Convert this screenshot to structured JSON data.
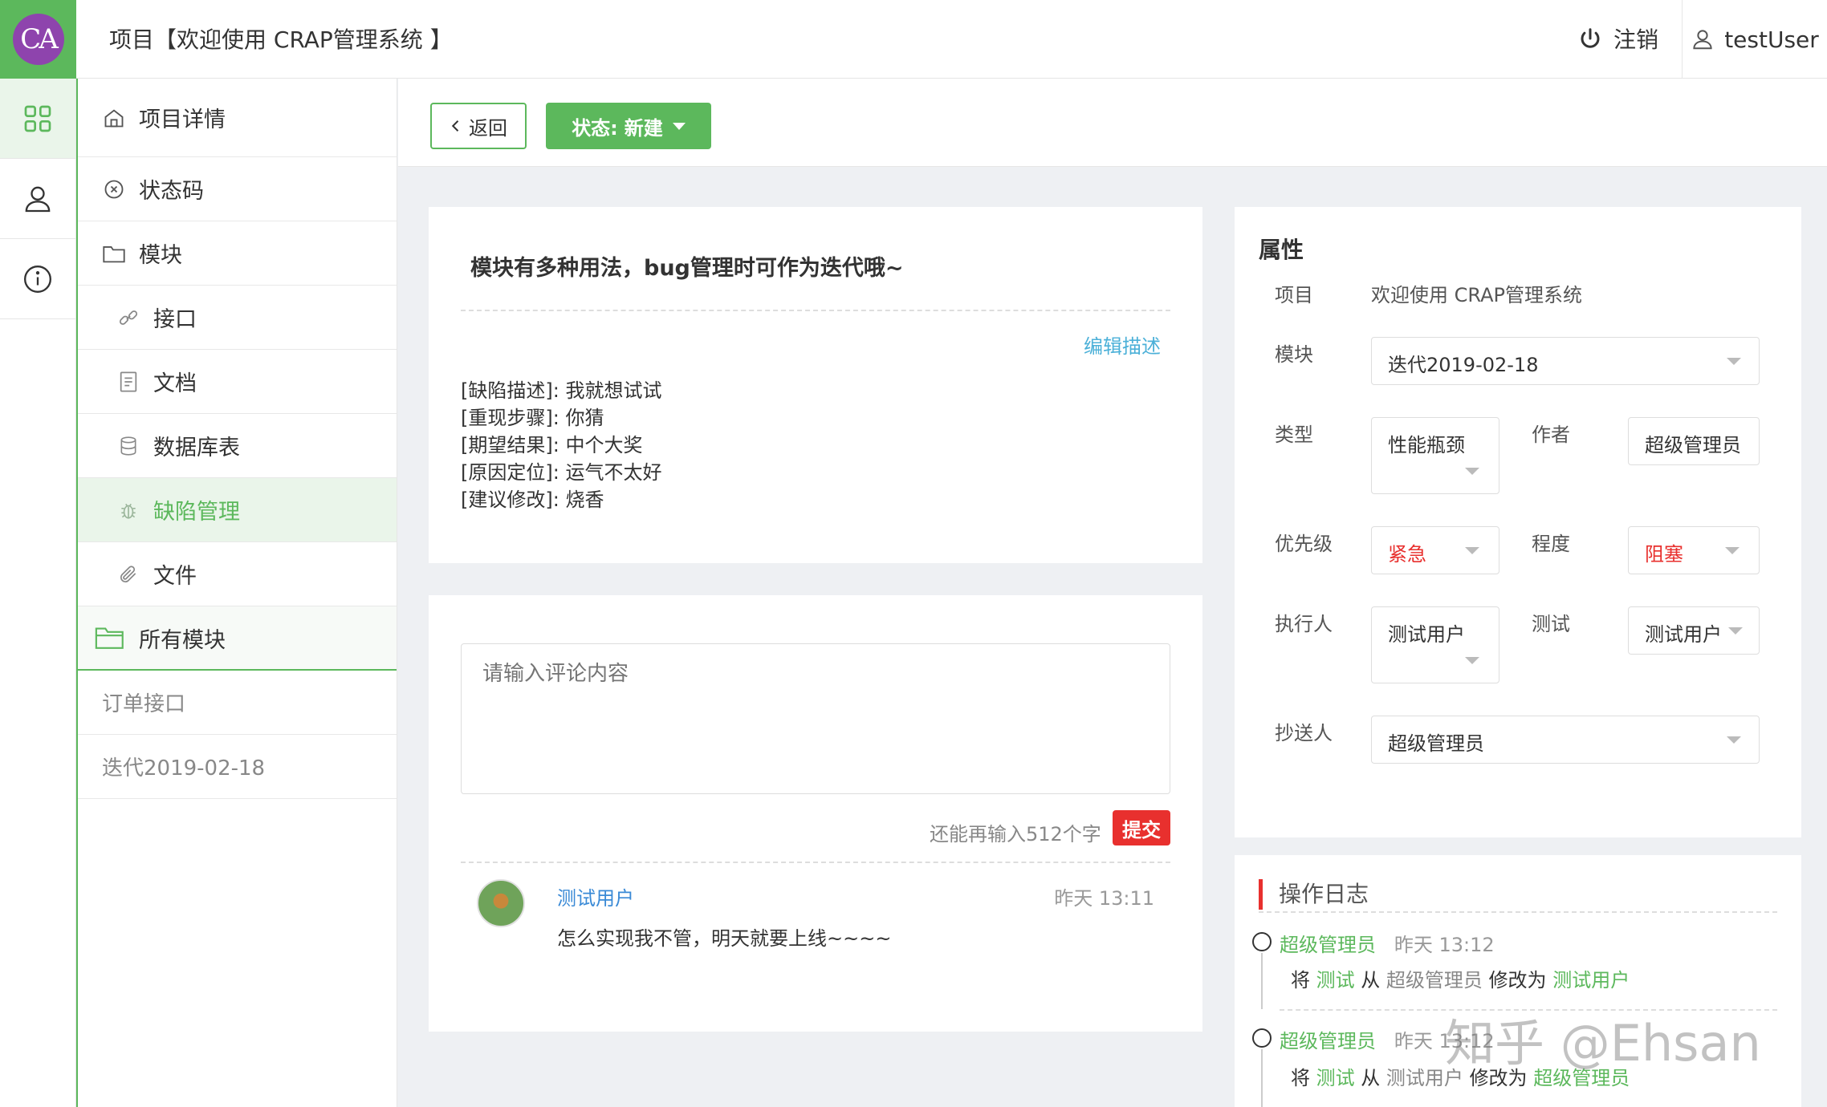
{
  "header": {
    "logo_text": "CA",
    "title": "项目【欢迎使用 CRAP管理系统 】",
    "logout_label": "注销",
    "username": "testUser"
  },
  "rail": [
    "apps-icon",
    "user-icon",
    "info-icon"
  ],
  "sidenav": {
    "items": [
      {
        "label": "项目详情",
        "icon": "home-icon"
      },
      {
        "label": "状态码",
        "icon": "close-circle-icon"
      },
      {
        "label": "模块",
        "icon": "folder-icon"
      },
      {
        "label": "接口",
        "icon": "link-icon"
      },
      {
        "label": "文档",
        "icon": "document-icon"
      },
      {
        "label": "数据库表",
        "icon": "database-icon"
      },
      {
        "label": "缺陷管理",
        "icon": "bug-icon"
      },
      {
        "label": "文件",
        "icon": "paperclip-icon"
      }
    ],
    "all_modules": "所有模块",
    "modules": [
      "订单接口",
      "迭代2019-02-18"
    ]
  },
  "toolbar": {
    "back_label": "返回",
    "status_label": "状态:",
    "status_value": "新建"
  },
  "description": {
    "title": "模块有多种用法，bug管理时可作为迭代哦~",
    "edit_label": "编辑描述",
    "lines": [
      "[缺陷描述]:  我就想试试",
      "[重现步骤]:  你猜",
      "[期望结果]:  中个大奖",
      "[原因定位]:  运气不太好",
      "[建议修改]:  烧香"
    ]
  },
  "comment": {
    "placeholder": "请输入评论内容",
    "remaining": "还能再输入512个字",
    "submit_label": "提交",
    "items": [
      {
        "user": "测试用户",
        "time": "昨天 13:11",
        "text": "怎么实现我不管，明天就要上线~~~~"
      }
    ]
  },
  "properties": {
    "title": "属性",
    "project_label": "项目",
    "project_value": "欢迎使用 CRAP管理系统",
    "module_label": "模块",
    "module_value": "迭代2019-02-18",
    "type_label": "类型",
    "type_value": "性能瓶颈",
    "author_label": "作者",
    "author_value": "超级管理员",
    "priority_label": "优先级",
    "priority_value": "紧急",
    "severity_label": "程度",
    "severity_value": "阻塞",
    "executor_label": "执行人",
    "executor_value": "测试用户",
    "tester_label": "测试",
    "tester_value": "测试用户",
    "cc_label": "抄送人",
    "cc_value": "超级管理员",
    "accent_red": "#e8302e"
  },
  "log": {
    "title": "操作日志",
    "entries": [
      {
        "user": "超级管理员",
        "time": "昨天 13:12",
        "pre": "将",
        "field": "测试",
        "from_word": "从",
        "from": "超级管理员",
        "to_word": "修改为",
        "to": "测试用户"
      },
      {
        "user": "超级管理员",
        "time": "昨天 13:12",
        "pre": "将",
        "field": "测试",
        "from_word": "从",
        "from": "测试用户",
        "to_word": "修改为",
        "to": "超级管理员"
      }
    ]
  },
  "watermark": "知乎 @Ehsan",
  "colors": {
    "brand": "#5cb85c",
    "link": "#4bb0d8",
    "danger": "#e8302e"
  }
}
